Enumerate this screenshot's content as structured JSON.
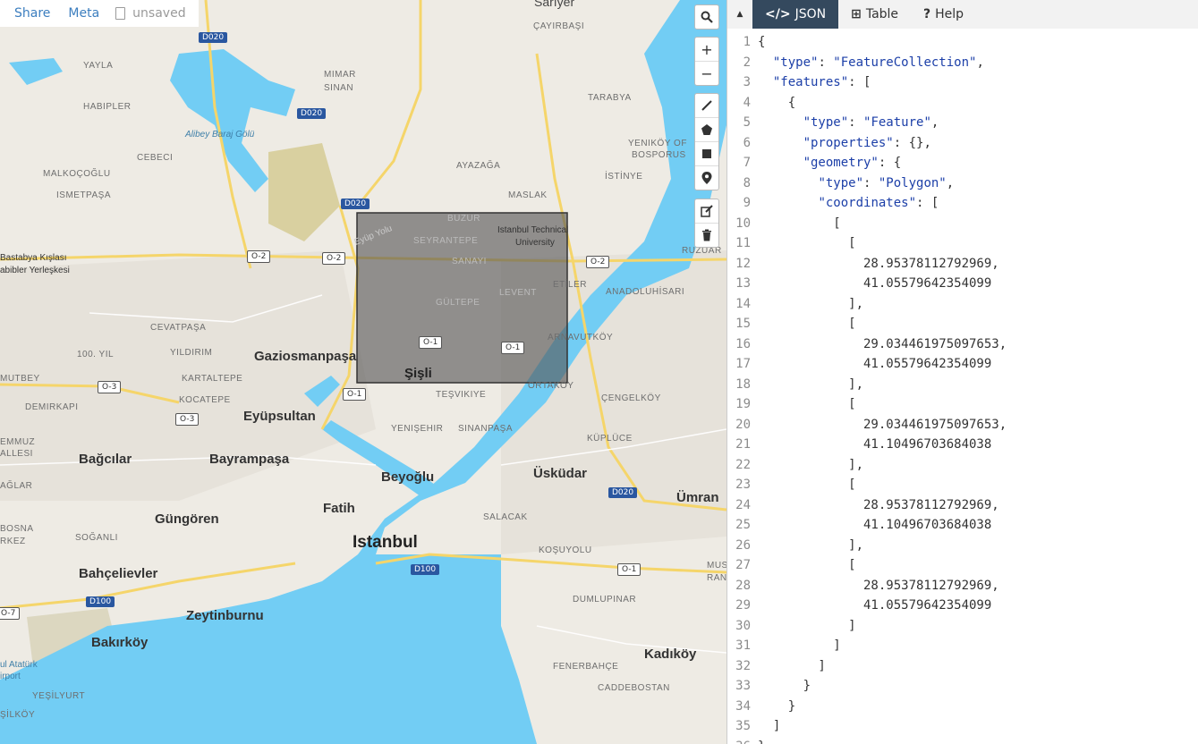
{
  "topbar": {
    "share": "Share",
    "meta": "Meta",
    "status": "unsaved"
  },
  "map_controls": {
    "search": "search",
    "zoom_in": "+",
    "zoom_out": "−"
  },
  "tabs": [
    {
      "label": "JSON",
      "icon": "</>",
      "active": true
    },
    {
      "label": "Table",
      "icon": "⊞",
      "active": false
    },
    {
      "label": "Help",
      "icon": "?",
      "active": false
    }
  ],
  "map_labels": {
    "cities": [
      "Gaziosmanpaşa",
      "Eyüpsultan",
      "Bağcılar",
      "Bayrampaşa",
      "Beyoğlu",
      "Üsküdar",
      "Fatih",
      "Güngören",
      "Bahçelievler",
      "Zeytinburnu",
      "Bakırköy",
      "Kadıköy",
      "Şişli",
      "Ümran"
    ],
    "major": "Istanbul",
    "districts": [
      "YAYLA",
      "MIMAR",
      "SINAN",
      "HABIPLER",
      "CEBECI",
      "MALKOÇOĞLU",
      "ISMETPAŞA",
      "AYAZAĞA",
      "MASLAK",
      "TARABYA",
      "ÇAYIRBAŞI",
      "İSTİNYE",
      "YENIKÖY OF",
      "BOSPORUS",
      "BUZUR",
      "SEYRANTEPE",
      "SANAYI",
      "GÜLTEPE",
      "LEVENT",
      "ETİLER",
      "ANADOLUHİSARI",
      "RUZUAR",
      "ARNAVUTKÖY",
      "ORTAKÖY",
      "ÇENGELKÖY",
      "KÜPLÜCE",
      "TEŞVIKIYE",
      "YENIŞEHIR",
      "SINANPAŞA",
      "CEVATPAŞA",
      "YILDIRIM",
      "KARTALTEPE",
      "KOCATEPE",
      "DEMIRKAPI",
      "100. YIL",
      "MUTBEY",
      "SOĞANLI",
      "SALACAK",
      "KOŞUYOLU",
      "DUMLUPINAR",
      "FENERBAHÇE",
      "CADDEBOSTAN",
      "YEŞİLYURT",
      "ŞİLKÖY",
      "EMMUZ",
      "ALLESI",
      "AĞLAR",
      "BOSNA",
      "RKEZ",
      "MUST",
      "RAN",
      "Sarıyer"
    ],
    "water": "Alibey Baraj Gölü",
    "pois": [
      "Bastabya Kışlası",
      "abibler Yerleşkesi",
      "Istanbul Technical",
      "University",
      "ul Atatürk",
      "irport"
    ],
    "roads": [
      "D020",
      "D020",
      "D020",
      "D020",
      "O-2",
      "O-2",
      "O-2",
      "O-1",
      "O-1",
      "O-1",
      "O-1",
      "O-3",
      "O-3",
      "D100",
      "D100",
      "O-7"
    ],
    "street": "Eyüp Yolu"
  },
  "json_lines": [
    "{",
    "  \"type\": \"FeatureCollection\",",
    "  \"features\": [",
    "    {",
    "      \"type\": \"Feature\",",
    "      \"properties\": {},",
    "      \"geometry\": {",
    "        \"type\": \"Polygon\",",
    "        \"coordinates\": [",
    "          [",
    "            [",
    "              28.95378112792969,",
    "              41.05579642354099",
    "            ],",
    "            [",
    "              29.034461975097653,",
    "              41.05579642354099",
    "            ],",
    "            [",
    "              29.034461975097653,",
    "              41.10496703684038",
    "            ],",
    "            [",
    "              28.95378112792969,",
    "              41.10496703684038",
    "            ],",
    "            [",
    "              28.95378112792969,",
    "              41.05579642354099",
    "            ]",
    "          ]",
    "        ]",
    "      }",
    "    }",
    "  ]",
    "}"
  ],
  "colors": {
    "water": "#72cdf4",
    "land": "#eeebe4",
    "park": "#d9d0a0",
    "road": "#f5d56a",
    "accent": "#3c7ebf",
    "tab_active": "#34495e"
  }
}
